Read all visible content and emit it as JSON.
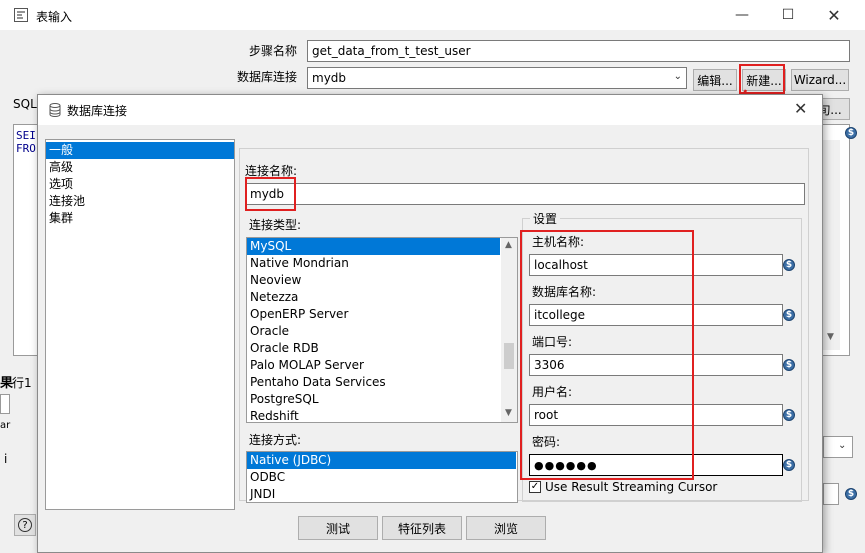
{
  "bg_window": {
    "title": "表输入",
    "step_name_label": "步骤名称",
    "step_name_value": "get_data_from_t_test_user",
    "db_conn_label": "数据库连接",
    "db_conn_value": "mydb",
    "edit_btn": "编辑...",
    "new_btn": "新建...",
    "wizard_btn": "Wizard...",
    "sql_label": "SQL",
    "query_btn_partial": "旬...",
    "sql_line1": "SEI",
    "sql_line2": "FRO",
    "left_frag1": "果",
    "left_frag2": "行1",
    "left_frag3": "ar",
    "left_frag4": "i"
  },
  "dialog": {
    "title": "数据库连接",
    "nav_items": [
      "一般",
      "高级",
      "选项",
      "连接池",
      "集群"
    ],
    "selected_nav": "一般",
    "conn_name_label": "连接名称:",
    "conn_name_value": "mydb",
    "conn_type_label": "连接类型:",
    "conn_types": [
      "MySQL",
      "Native Mondrian",
      "Neoview",
      "Netezza",
      "OpenERP Server",
      "Oracle",
      "Oracle RDB",
      "Palo MOLAP Server",
      "Pentaho Data Services",
      "PostgreSQL",
      "Redshift"
    ],
    "selected_conn_type": "MySQL",
    "access_label": "连接方式:",
    "access_types": [
      "Native (JDBC)",
      "ODBC",
      "JNDI"
    ],
    "selected_access": "Native (JDBC)",
    "settings_label": "设置",
    "host_label": "主机名称:",
    "host_value": "localhost",
    "dbname_label": "数据库名称:",
    "dbname_value": "itcollege",
    "port_label": "端口号:",
    "port_value": "3306",
    "user_label": "用户名:",
    "user_value": "root",
    "password_label": "密码:",
    "password_value": "●●●●●●",
    "streaming_label": "Use Result Streaming Cursor",
    "btn_test": "测试",
    "btn_features": "特征列表",
    "btn_browse": "浏览"
  },
  "colors": {
    "accent": "#0078d7",
    "highlight": "#e02020"
  }
}
